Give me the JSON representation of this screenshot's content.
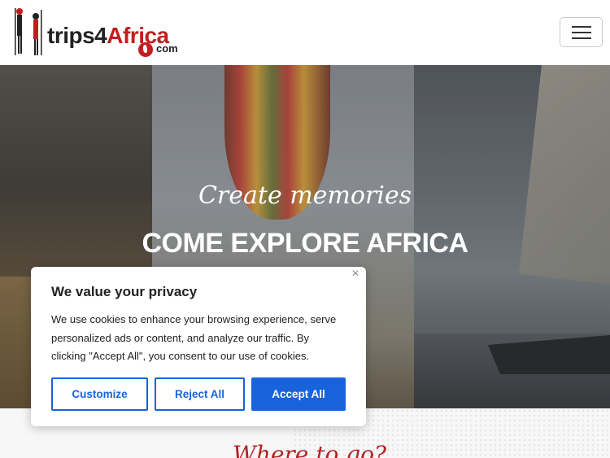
{
  "header": {
    "logo_word_main": "trips4",
    "logo_word_accent": "Africa",
    "logo_suffix": "com",
    "menu_icon": "hamburger-icon"
  },
  "hero": {
    "script_line": "Create memories",
    "headline": "COME EXPLORE AFRICA"
  },
  "band": {
    "script_partial": "Where to go?"
  },
  "cookie_banner": {
    "title": "We value your privacy",
    "body": "We use cookies to enhance your browsing experience, serve personalized ads or content, and analyze our traffic. By clicking \"Accept All\", you consent to our use of cookies.",
    "close_icon": "close-icon",
    "customize_label": "Customize",
    "reject_label": "Reject All",
    "accept_label": "Accept All"
  },
  "colors": {
    "brand_red": "#c41d1d",
    "accent_blue": "#1863dc"
  }
}
